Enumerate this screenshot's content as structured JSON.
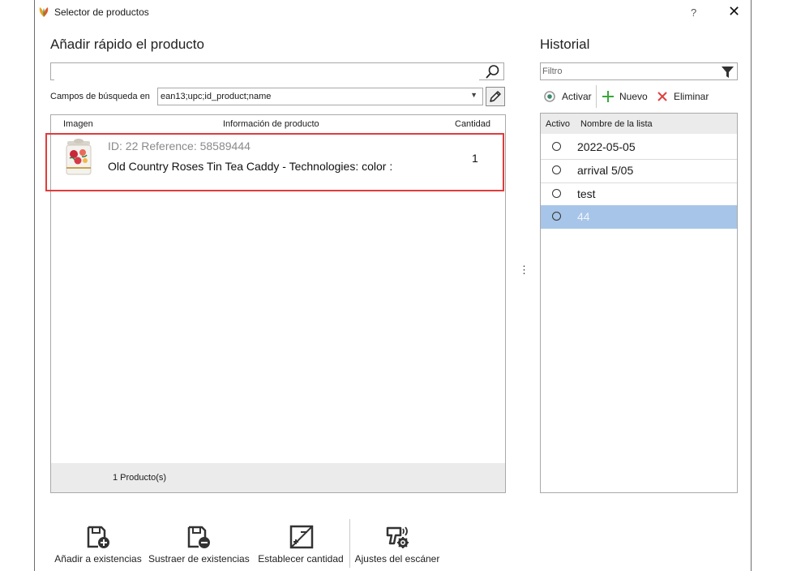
{
  "window": {
    "title": "Selector de productos",
    "help": "?",
    "close": "✕"
  },
  "quick_add": {
    "heading": "Añadir rápido el producto",
    "search_value": "",
    "fields_label": "Campos de búsqueda en",
    "fields_value": "ean13;upc;id_product;name"
  },
  "grid": {
    "columns": [
      "Imagen",
      "Información de producto",
      "Cantidad"
    ],
    "rows": [
      {
        "meta": "ID: 22 Reference: 58589444",
        "name": "Old Country Roses Tin Tea Caddy - Technologies:  color :",
        "qty": "1"
      }
    ],
    "footer": "1 Producto(s)"
  },
  "history": {
    "heading": "Historial",
    "filter_placeholder": "Filtro",
    "toolbar": {
      "activate": "Activar",
      "new": "Nuevo",
      "delete": "Eliminar"
    },
    "columns": [
      "Activo",
      "Nombre de la lista"
    ],
    "items": [
      {
        "name": "2022-05-05",
        "selected": false
      },
      {
        "name": "arrival 5/05",
        "selected": false
      },
      {
        "name": "test",
        "selected": false
      },
      {
        "name": "44",
        "selected": true
      }
    ]
  },
  "splitter": "⋮",
  "bottom_toolbar": {
    "add_stock": "Añadir a existencias",
    "subtract_stock": "Sustraer de existencias",
    "set_quantity": "Establecer cantidad",
    "scanner_settings": "Ajustes del escáner"
  },
  "colors": {
    "accent_highlight": "#e03c3c",
    "selection": "#a7c5e8",
    "add_green": "#3aa63a",
    "delete_red": "#e04040"
  }
}
